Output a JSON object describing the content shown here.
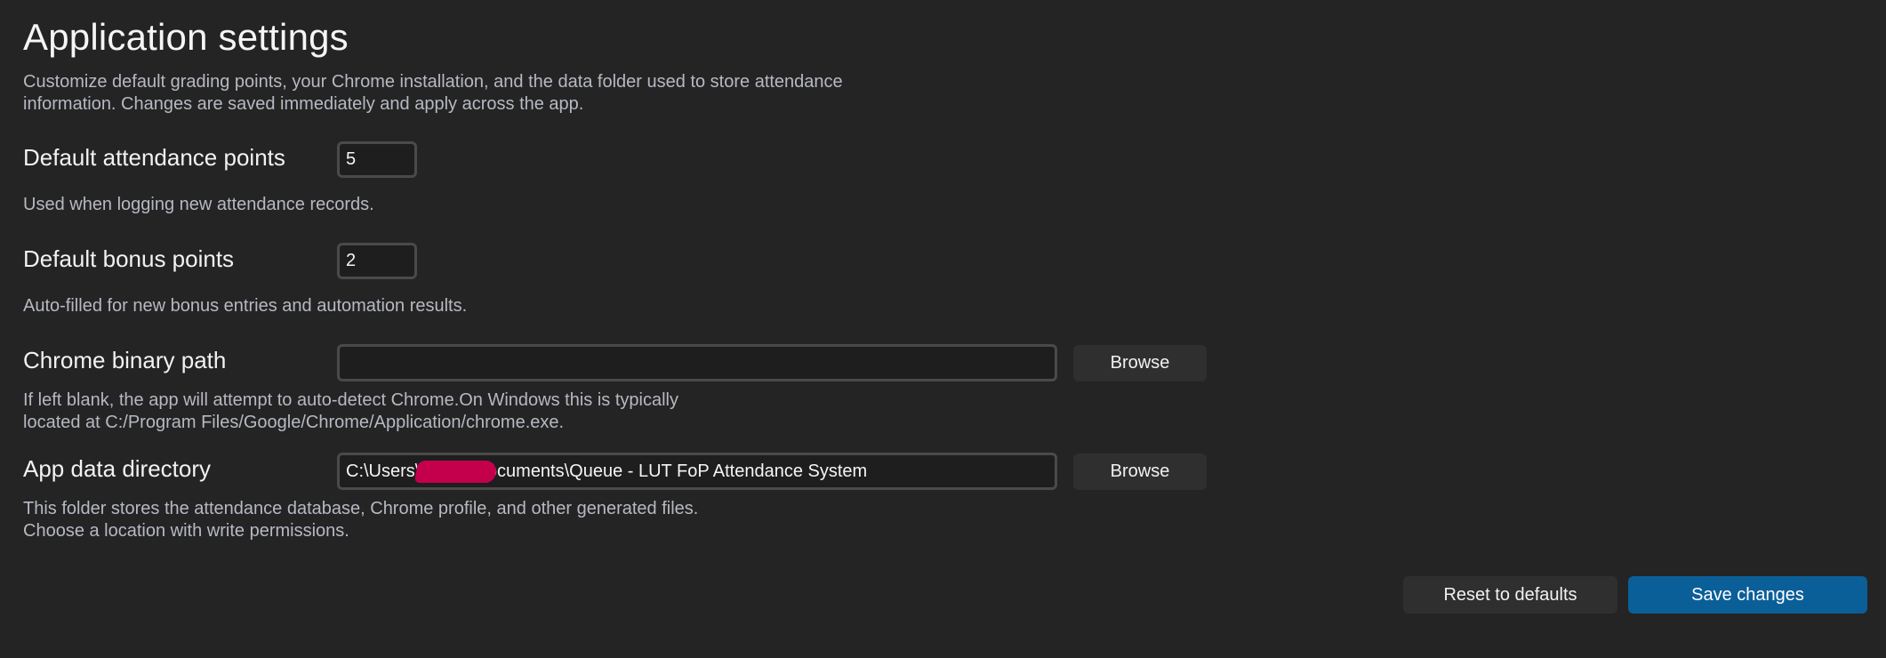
{
  "header": {
    "title": "Application settings",
    "description": "Customize default grading points, your Chrome installation, and the data folder used to store attendance information. Changes are saved immediately and apply across the app."
  },
  "settings": {
    "attendance": {
      "label": "Default attendance points",
      "value": "5",
      "help": "Used when logging new attendance records."
    },
    "bonus": {
      "label": "Default bonus points",
      "value": "2",
      "help": "Auto-filled for new bonus entries and automation results."
    },
    "chrome": {
      "label": "Chrome binary path",
      "value": "",
      "browse_label": "Browse",
      "help_line1": "If left blank, the app will attempt to auto-detect Chrome.On Windows this is typically",
      "help_line2": "located at C:/Program Files/Google/Chrome/Application/chrome.exe."
    },
    "data_dir": {
      "label": "App data directory",
      "value": "C:\\Users\\          \\Documents\\Queue - LUT FoP Attendance System",
      "browse_label": "Browse",
      "help_line1": "This folder stores the attendance database, Chrome profile, and other generated files.",
      "help_line2": "Choose a location with write permissions."
    }
  },
  "footer": {
    "reset_label": "Reset to defaults",
    "save_label": "Save changes"
  },
  "colors": {
    "background": "#242424",
    "primary_button": "#0b5f99",
    "redaction": "#c4004d"
  }
}
